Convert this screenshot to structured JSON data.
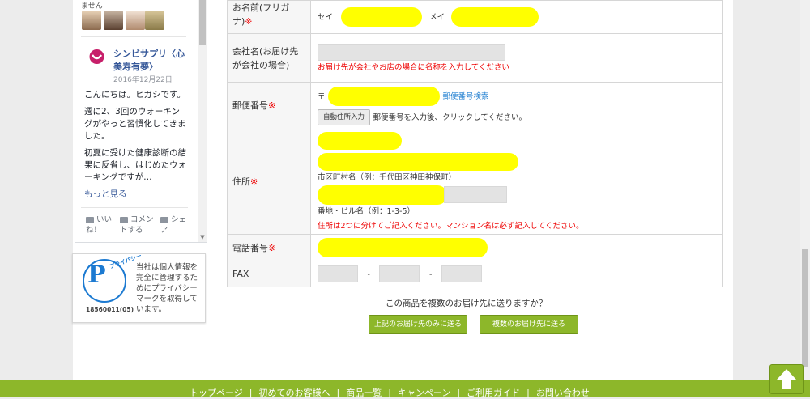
{
  "facebook_widget": {
    "top_text": "ません",
    "page_name": "シンビサプリ〈心美寿有夢〉",
    "logo_text": "シンビサプリ",
    "post_date": "2016年12月22日",
    "post_paragraphs": [
      "こんにちは。ヒガシです。",
      "週に2、3回のウォーキングがやっと習慣化してきました。",
      "初夏に受けた健康診断の結果に反省し、はじめたウォーキングですが…"
    ],
    "more_link": "もっと見る",
    "actions": [
      {
        "label": "いい\nね！",
        "icon": "like-icon"
      },
      {
        "label": "コメン\nトする",
        "icon": "comment-icon"
      },
      {
        "label": "シェ\nア",
        "icon": "share-icon"
      }
    ]
  },
  "privacy_mark": {
    "ring_text": "プライバシー",
    "number": "18560011(05)",
    "description": "当社は個人情報を完全に管理するためにプライバシーマークを取得しています。"
  },
  "form": {
    "furigana": {
      "label": "お名前(フリガナ)",
      "req": "※",
      "sei": "セイ",
      "mei": "メイ"
    },
    "company": {
      "label": "会社名(お届け先が会社の場合)",
      "note": "お届け先が会社やお店の場合に名称を入力してください"
    },
    "postal": {
      "label": "郵便番号",
      "req": "※",
      "prefix": "〒",
      "search_link": "郵便番号検索",
      "auto_button": "自動住所入力",
      "auto_hint": "郵便番号を入力後、クリックしてください。"
    },
    "address": {
      "label": "住所",
      "req": "※",
      "hint1": "市区町村名（例：千代田区神田神保町）",
      "hint2": "番地・ビル名（例：1-3-5）",
      "note": "住所は2つに分けてご記入ください。マンション名は必ず記入してください。"
    },
    "phone": {
      "label": "電話番号",
      "req": "※"
    },
    "fax": {
      "label": "FAX",
      "dash": "-"
    }
  },
  "multi_delivery": {
    "question": "この商品を複数のお届け先に送りますか？",
    "single_button": "上記のお届け先のみに送る",
    "multi_button": "複数のお届け先に送る"
  },
  "footer": {
    "nav": [
      "トップページ",
      "初めてのお客様へ",
      "商品一覧",
      "キャンペーン",
      "ご利用ガイド",
      "お問い合わせ"
    ],
    "separator": "|"
  },
  "colors": {
    "accent_green": "#8db72a",
    "required_red": "#e00000",
    "link_blue": "#1f7ed0",
    "redaction_yellow": "#ffff00"
  }
}
